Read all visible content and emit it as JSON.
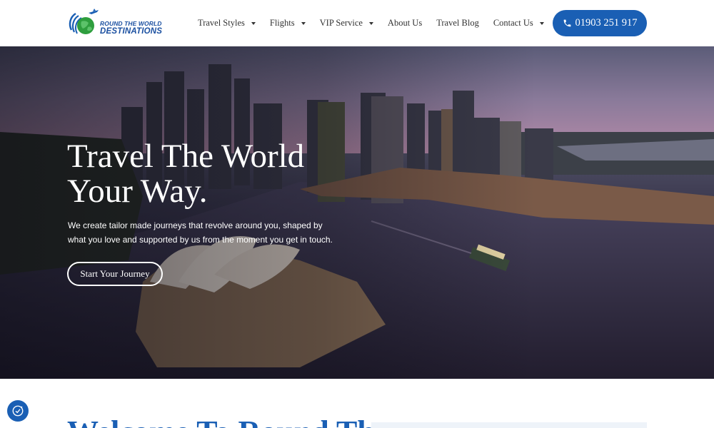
{
  "brand": {
    "line1": "ROUND THE WORLD",
    "line2": "DESTINATIONS",
    "icon": "globe-airplane-logo"
  },
  "nav": {
    "items": [
      {
        "label": "Travel Styles",
        "dropdown": true
      },
      {
        "label": "Flights",
        "dropdown": true
      },
      {
        "label": "VIP Service",
        "dropdown": true
      },
      {
        "label": "About Us",
        "dropdown": false
      },
      {
        "label": "Travel Blog",
        "dropdown": false
      },
      {
        "label": "Contact Us",
        "dropdown": true
      }
    ]
  },
  "phone": {
    "number": "01903 251 917",
    "icon": "phone-icon"
  },
  "hero": {
    "title_line1": "Travel The World",
    "title_line2": "Your Way.",
    "subtitle": "We create tailor made journeys that revolve around you, shaped by what you love and supported by us from the moment you get in touch.",
    "cta_label": "Start Your Journey",
    "image_subject": "Sydney harbour aerial view at dusk"
  },
  "below": {
    "heading_partial": "Welcome To Round The"
  },
  "cookie": {
    "icon": "cookie-consent-icon"
  },
  "colors": {
    "brand_blue": "#1a5fb4",
    "logo_green": "#2e9e3e",
    "nav_text": "#333333",
    "hero_text": "#ffffff"
  }
}
